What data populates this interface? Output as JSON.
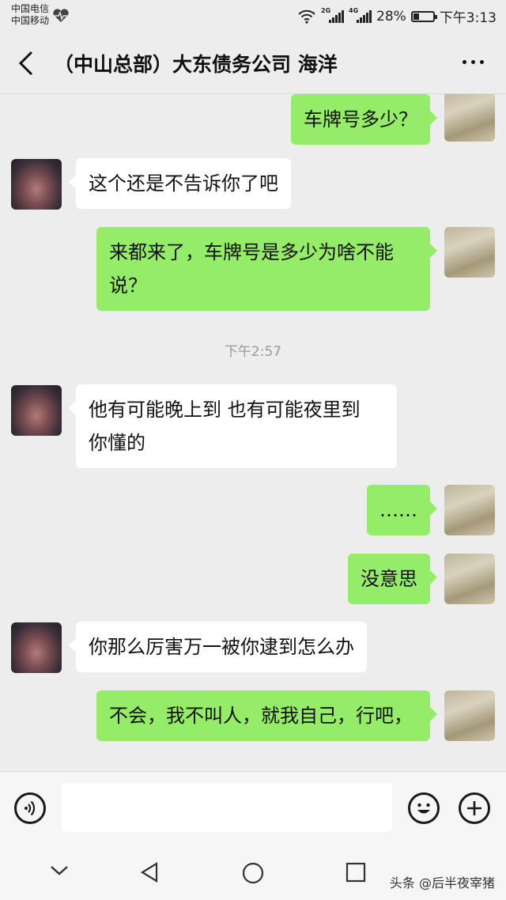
{
  "status_bar": {
    "carrier_1": "中国电信",
    "carrier_2": "中国移动",
    "net_1": "2G",
    "net_2": "4G",
    "battery": "28%",
    "battery_level": 0.28,
    "time": "下午3:13"
  },
  "header": {
    "title": "（中山总部）大东债务公司 海洋"
  },
  "messages": [
    {
      "side": "me",
      "text": "车牌号多少？"
    },
    {
      "side": "other",
      "text": "这个还是不告诉你了吧"
    },
    {
      "side": "me",
      "text": "来都来了，车牌号是多少为啥不能说？"
    },
    {
      "timestamp": "下午2:57"
    },
    {
      "side": "other",
      "text": "他有可能晚上到  也有可能夜里到  你懂的"
    },
    {
      "side": "me",
      "text": "……"
    },
    {
      "side": "me",
      "text": "没意思"
    },
    {
      "side": "other",
      "text": "你那么厉害万一被你逮到怎么办"
    },
    {
      "side": "me",
      "text": "不会，我不叫人，就我自己，行吧，"
    }
  ],
  "input": {
    "value": "",
    "placeholder": ""
  },
  "icons": {
    "voice": "voice-icon",
    "emoji": "emoji-icon",
    "plus": "plus-icon",
    "back": "back-arrow-icon",
    "more": "more-icon"
  },
  "watermark": "头条 @后半夜宰猪",
  "colors": {
    "background": "#ededed",
    "my_bubble": "#95ec69",
    "their_bubble": "#ffffff",
    "timestamp": "#999999"
  }
}
